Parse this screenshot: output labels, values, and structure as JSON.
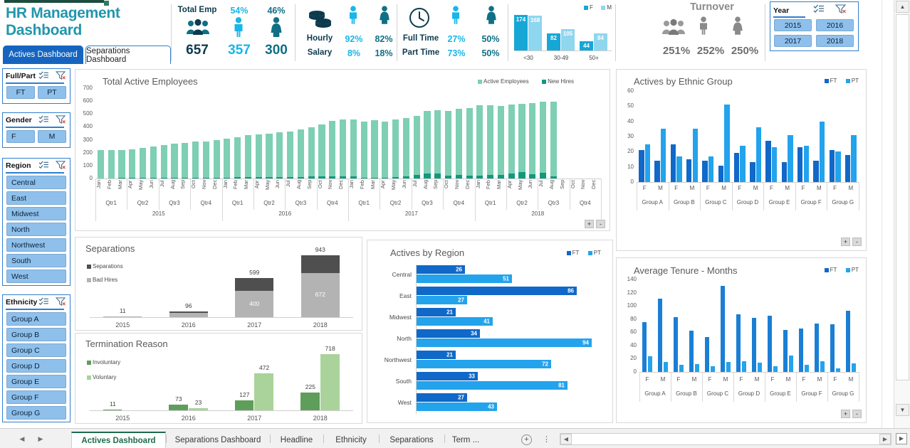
{
  "header": {
    "title": "HR Management Dashboard",
    "tabs": [
      {
        "label": "Actives Dashboard",
        "active": true
      },
      {
        "label": "Separations Dashboard",
        "active": false
      }
    ],
    "kpis": {
      "total_emp": {
        "label": "Total Emp",
        "value": "657",
        "icon": "people-group-icon"
      },
      "male": {
        "pct": "54%",
        "value": "357",
        "icon": "male-figure-icon"
      },
      "female": {
        "pct": "46%",
        "value": "300",
        "icon": "female-figure-icon"
      },
      "pay": {
        "row_labels": [
          "Hourly",
          "Salary"
        ],
        "icon": "coins-icon",
        "male": {
          "hourly": "92%",
          "salary": "8%",
          "icon": "male-figure-icon"
        },
        "female": {
          "hourly": "82%",
          "salary": "18%",
          "icon": "female-figure-icon"
        }
      },
      "schedule": {
        "row_labels": [
          "Full Time",
          "Part Time"
        ],
        "icon": "clock-icon",
        "male": {
          "full_time": "27%",
          "part_time": "73%",
          "icon": "male-figure-icon"
        },
        "female": {
          "full_time": "50%",
          "part_time": "50%",
          "icon": "female-figure-icon"
        }
      }
    },
    "turnover": {
      "title": "Turnover",
      "total": "251%",
      "male": "252%",
      "female": "250%",
      "icons": [
        "people-group-icon",
        "male-figure-icon",
        "female-figure-icon"
      ]
    },
    "year_slicer": {
      "title": "Year",
      "multiselect_icon": "multi-select-icon",
      "clear_filter_icon": "clear-filter-icon",
      "items": [
        "2015",
        "2016",
        "2017",
        "2018"
      ]
    }
  },
  "slicers": [
    {
      "title": "Full/Part",
      "items": [
        "FT",
        "PT"
      ],
      "layout": "grid2"
    },
    {
      "title": "Gender",
      "items": [
        "F",
        "M"
      ],
      "layout": "grid2"
    },
    {
      "title": "Region",
      "items": [
        "Central",
        "East",
        "Midwest",
        "North",
        "Northwest",
        "South",
        "West"
      ],
      "layout": "list"
    },
    {
      "title": "Ethnicity",
      "items": [
        "Group A",
        "Group B",
        "Group C",
        "Group D",
        "Group E",
        "Group F",
        "Group G"
      ],
      "layout": "list"
    }
  ],
  "colors": {
    "brand_teal": "#2196ad",
    "cyan": "#19b6e8",
    "dark_teal": "#0f6f86",
    "navy": "#0d3b4d",
    "blue_ft": "#1068c9",
    "blue_pt": "#23a3ec",
    "green_light": "#7ecfb4",
    "green_dark": "#11987f",
    "grey_dark": "#5a5a5a",
    "grey_light": "#b3b3b3",
    "invol_green": "#5e9e5a",
    "vol_green": "#a9d39a",
    "slicer_blue": "#8fc0ec"
  },
  "chart_data": [
    {
      "id": "total-active-employees",
      "type": "bar",
      "title": "Total Active Employees",
      "stacked": true,
      "legend": [
        "Active Employees",
        "New Hires"
      ],
      "legend_position": "top-right",
      "ylabel": "",
      "xlabel": "",
      "ylim": [
        0,
        700
      ],
      "yticks": [
        0,
        100,
        200,
        300,
        400,
        500,
        600,
        700
      ],
      "months": [
        "Jan",
        "Feb",
        "Mar",
        "Apr",
        "May",
        "Jun",
        "Jul",
        "Aug",
        "Sep",
        "Oct",
        "Nov",
        "Dec"
      ],
      "quarters": [
        "Qtr1",
        "Qtr2",
        "Qtr3",
        "Qtr4"
      ],
      "years": [
        "2015",
        "2016",
        "2017",
        "2018"
      ],
      "series": [
        {
          "name": "Active Employees",
          "values": [
            222,
            222,
            222,
            228,
            238,
            246,
            257,
            269,
            275,
            286,
            285,
            297,
            308,
            320,
            336,
            341,
            348,
            359,
            364,
            381,
            396,
            419,
            444,
            460,
            455,
            443,
            450,
            443,
            457,
            467,
            485,
            525,
            530,
            523,
            541,
            548,
            565,
            570,
            560,
            574,
            581,
            584,
            593,
            597
          ]
        },
        {
          "name": "New Hires",
          "values": [
            2,
            2,
            3,
            4,
            5,
            5,
            6,
            8,
            6,
            7,
            6,
            8,
            8,
            9,
            10,
            10,
            9,
            11,
            12,
            13,
            14,
            16,
            17,
            18,
            17,
            4,
            8,
            8,
            11,
            17,
            26,
            36,
            41,
            22,
            25,
            23,
            24,
            28,
            26,
            37,
            50,
            31,
            44,
            15
          ]
        }
      ],
      "zoom_controls": [
        "+",
        "-"
      ]
    },
    {
      "id": "actives-by-ethnic-group",
      "type": "bar",
      "title": "Actives by Ethnic Group",
      "legend": [
        "FT",
        "PT"
      ],
      "legend_position": "top-right",
      "ylim": [
        0,
        60
      ],
      "yticks": [
        0,
        10,
        20,
        30,
        40,
        50,
        60
      ],
      "groups": [
        "Group A",
        "Group B",
        "Group C",
        "Group D",
        "Group E",
        "Group F",
        "Group G"
      ],
      "genders": [
        "F",
        "M"
      ],
      "series": [
        {
          "name": "FT",
          "values": [
            21,
            14,
            25,
            15,
            14,
            11,
            19,
            13,
            27,
            13,
            23,
            14,
            21,
            18
          ]
        },
        {
          "name": "PT",
          "values": [
            25,
            35,
            17,
            35,
            17,
            51,
            24,
            36,
            23,
            31,
            24,
            40,
            20,
            31
          ]
        }
      ],
      "zoom_controls": [
        "+",
        "-"
      ]
    },
    {
      "id": "separations",
      "type": "bar",
      "title": "Separations",
      "stacked": true,
      "legend": [
        "Separations",
        "Bad Hires"
      ],
      "legend_position": "top-left",
      "categories": [
        "2015",
        "2016",
        "2017",
        "2018"
      ],
      "totals": [
        11,
        96,
        599,
        943
      ],
      "series": [
        {
          "name": "Bad Hires",
          "values": [
            8,
            70,
            400,
            672
          ]
        },
        {
          "name": "Separations",
          "values": [
            3,
            26,
            199,
            271
          ]
        }
      ],
      "data_labels_inner": [
        "",
        "",
        "400",
        "672"
      ],
      "ylim": [
        0,
        1000
      ]
    },
    {
      "id": "termination-reason",
      "type": "bar",
      "title": "Termination Reason",
      "legend": [
        "Involuntary",
        "Voluntary"
      ],
      "legend_position": "left",
      "categories": [
        "2015",
        "2016",
        "2017",
        "2018"
      ],
      "series": [
        {
          "name": "Involuntary",
          "values": [
            11,
            73,
            127,
            225
          ]
        },
        {
          "name": "Voluntary",
          "values": [
            0,
            23,
            472,
            718
          ]
        }
      ],
      "ylim": [
        0,
        800
      ]
    },
    {
      "id": "actives-by-region",
      "type": "bar",
      "orientation": "horizontal",
      "title": "Actives by Region",
      "legend": [
        "FT",
        "PT"
      ],
      "legend_position": "top-right",
      "categories": [
        "Central",
        "East",
        "Midwest",
        "North",
        "Northwest",
        "South",
        "West"
      ],
      "series": [
        {
          "name": "FT",
          "values": [
            26,
            86,
            21,
            34,
            21,
            33,
            27
          ]
        },
        {
          "name": "PT",
          "values": [
            51,
            27,
            41,
            94,
            72,
            81,
            43
          ]
        }
      ],
      "xlim": [
        0,
        100
      ]
    },
    {
      "id": "average-tenure-months",
      "type": "bar",
      "title": "Average Tenure - Months",
      "legend": [
        "FT",
        "PT"
      ],
      "legend_position": "top-right",
      "ylim": [
        0,
        140
      ],
      "yticks": [
        0,
        20,
        40,
        60,
        80,
        100,
        120,
        140
      ],
      "groups": [
        "Group A",
        "Group B",
        "Group C",
        "Group D",
        "Group E",
        "Group F",
        "Group G"
      ],
      "genders": [
        "F",
        "M"
      ],
      "series": [
        {
          "name": "FT",
          "values": [
            75,
            111,
            83,
            62,
            53,
            130,
            87,
            82,
            85,
            64,
            66,
            73,
            72,
            93
          ]
        },
        {
          "name": "PT",
          "values": [
            24,
            15,
            11,
            12,
            9,
            15,
            16,
            14,
            9,
            25,
            11,
            16,
            5,
            13
          ]
        }
      ],
      "zoom_controls": [
        "+",
        "-"
      ]
    },
    {
      "id": "age-group-header-chart",
      "type": "bar",
      "title": "",
      "legend": [
        "F",
        "M"
      ],
      "categories": [
        "<30",
        "30-49",
        "50+"
      ],
      "series": [
        {
          "name": "F",
          "values": [
            174,
            82,
            44
          ]
        },
        {
          "name": "M",
          "values": [
            168,
            105,
            84
          ]
        }
      ],
      "ylim": [
        0,
        180
      ]
    }
  ],
  "bottom": {
    "nav_prev_icon": "nav-prev-icon",
    "nav_next_icon": "nav-next-icon",
    "sheet_tabs": [
      {
        "label": "Actives Dashboard",
        "active": true
      },
      {
        "label": "Separations Dashboard",
        "active": false
      },
      {
        "label": "Headline",
        "active": false
      },
      {
        "label": "Ethnicity",
        "active": false
      },
      {
        "label": "Separations",
        "active": false
      },
      {
        "label": "Term  ...",
        "active": false
      }
    ],
    "add_sheet_label": "+",
    "overflow_label": "⋮",
    "scroll_left_icon": "scroll-left-icon",
    "scroll_right_icon": "scroll-right-icon"
  }
}
